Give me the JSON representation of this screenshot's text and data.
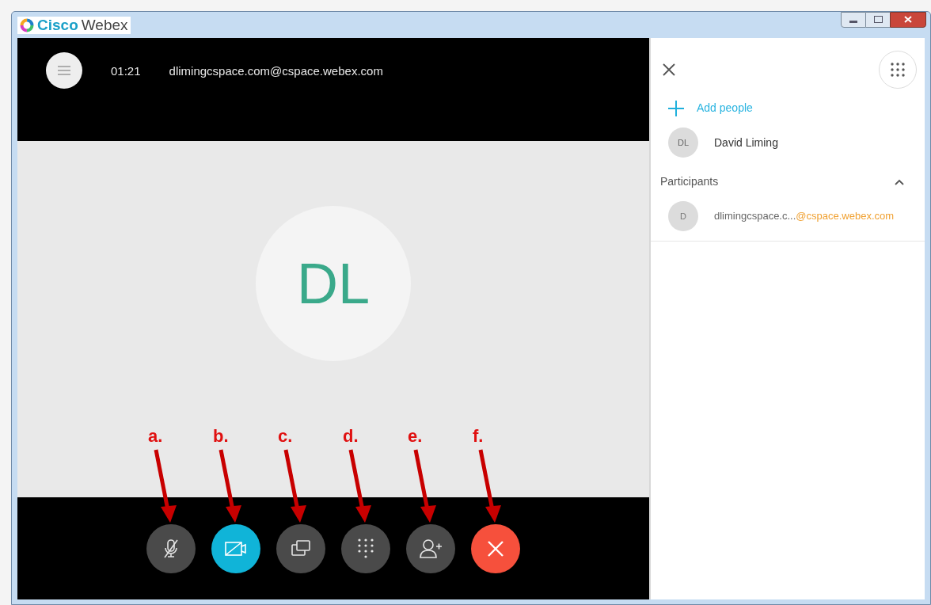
{
  "window": {
    "title_brand": "Cisco",
    "title_product": "Webex"
  },
  "call_header": {
    "duration": "01:21",
    "address": "dlimingcspace.com@cspace.webex.com"
  },
  "avatar": {
    "initials": "DL"
  },
  "controls": [
    {
      "kind": "mute",
      "annotation": "a."
    },
    {
      "kind": "video",
      "annotation": "b."
    },
    {
      "kind": "share",
      "annotation": "c."
    },
    {
      "kind": "keypad",
      "annotation": "d."
    },
    {
      "kind": "add-person",
      "annotation": "e."
    },
    {
      "kind": "end",
      "annotation": "f."
    }
  ],
  "panel": {
    "add_people": "Add people",
    "host": {
      "initials": "DL",
      "name": "David Liming"
    },
    "participants_header": "Participants",
    "participants_expanded": true,
    "participants": [
      {
        "initials": "D",
        "name": "dlimingcspace.c...",
        "domain": "@cspace.webex.com"
      }
    ]
  }
}
